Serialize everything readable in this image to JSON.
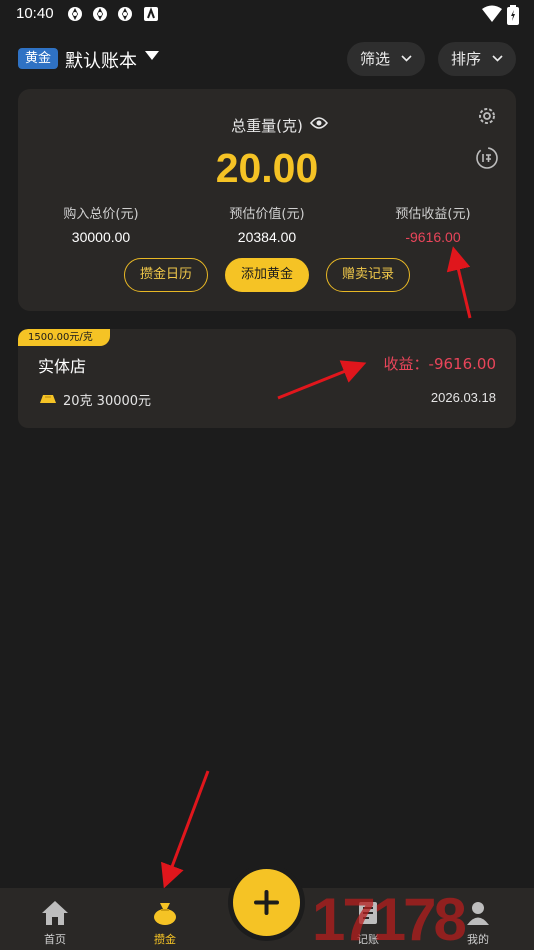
{
  "status_bar": {
    "time": "10:40"
  },
  "header": {
    "book_tag": "黄金",
    "book_name": "默认账本",
    "filter_label": "筛选",
    "sort_label": "排序"
  },
  "summary": {
    "weight_label": "总重量(克)",
    "weight_value": "20.00",
    "stats": [
      {
        "label": "购入总价(元)",
        "value": "30000.00"
      },
      {
        "label": "预估价值(元)",
        "value": "20384.00"
      },
      {
        "label": "预估收益(元)",
        "value": "-9616.00"
      }
    ],
    "buttons": {
      "calendar": "攒金日历",
      "add": "添加黄金",
      "sell_records": "赠卖记录"
    }
  },
  "records": [
    {
      "price_tag": "1500.00元/克",
      "store": "实体店",
      "profit": "收益：-9616.00",
      "amount": "20克 30000元",
      "date": "2026.03.18"
    }
  ],
  "nav": {
    "items": [
      {
        "label": "首页",
        "icon": "home-icon"
      },
      {
        "label": "攒金",
        "icon": "gold-bag-icon"
      },
      {
        "label": "记账",
        "icon": "ledger-icon"
      },
      {
        "label": "我的",
        "icon": "user-icon"
      }
    ]
  },
  "watermark": "17178",
  "colors": {
    "accent": "#f5c325",
    "negative": "#e9455a",
    "card": "#2a2826",
    "background": "#1c1c1c"
  }
}
